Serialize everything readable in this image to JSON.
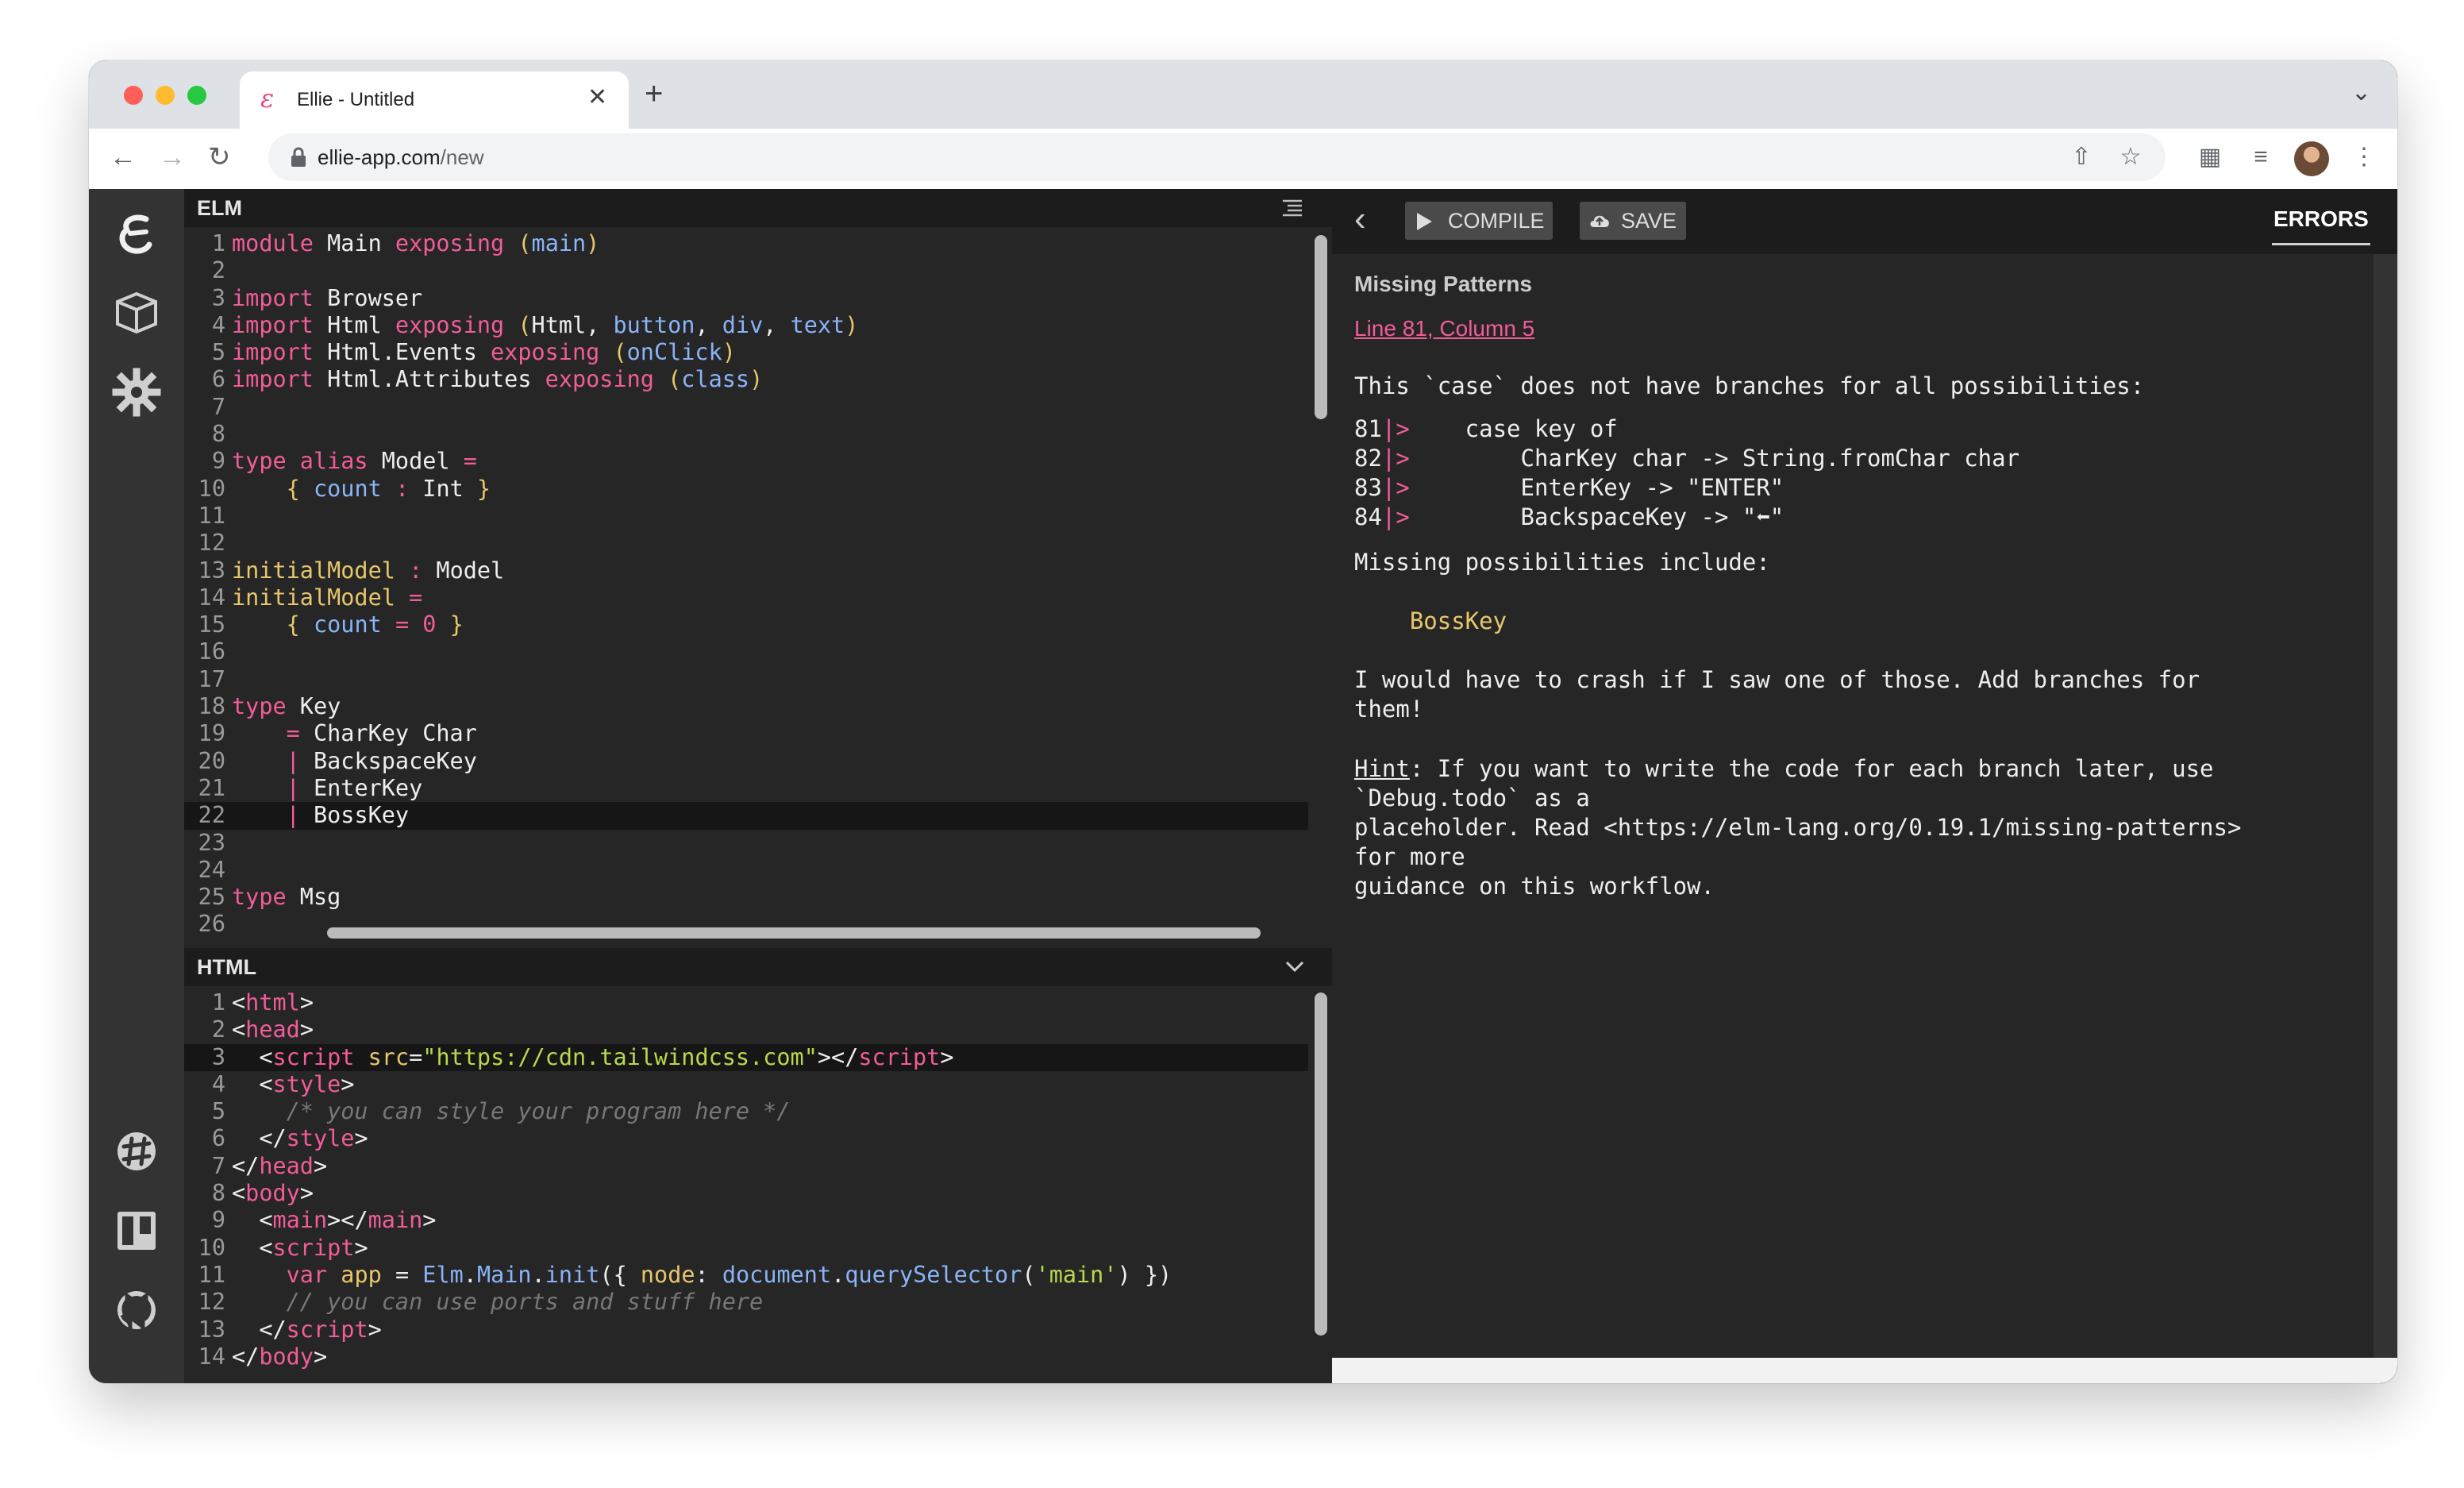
{
  "browser": {
    "tab_title": "Ellie - Untitled",
    "tab_favicon": "ε",
    "new_tab_glyph": "+",
    "tab_close_glyph": "✕",
    "tabstrip_menu_glyph": "⌄",
    "url_domain": "ellie-app.com",
    "url_path": "/new",
    "traffic_colors": [
      "#ff5f57",
      "#febc2e",
      "#28c840"
    ]
  },
  "sidebar": {
    "icons": [
      "ellie-logo-icon",
      "package-icon",
      "gear-icon",
      "slack-icon",
      "trello-icon",
      "github-icon"
    ]
  },
  "elm_pane": {
    "title": "ELM",
    "lines": [
      {
        "n": "1",
        "html": "<span class='kw'>module</span> Main <span class='kw'>exposing</span> <span class='attr'>(</span><span class='fld'>main</span><span class='attr'>)</span>"
      },
      {
        "n": "2",
        "html": ""
      },
      {
        "n": "3",
        "html": "<span class='kw'>import</span> Browser"
      },
      {
        "n": "4",
        "html": "<span class='kw'>import</span> Html <span class='kw'>exposing</span> <span class='attr'>(</span>Html, <span class='imp'>button</span>, <span class='imp'>div</span>, <span class='imp'>text</span><span class='attr'>)</span>"
      },
      {
        "n": "5",
        "html": "<span class='kw'>import</span> Html.Events <span class='kw'>exposing</span> <span class='attr'>(</span><span class='imp'>onClick</span><span class='attr'>)</span>"
      },
      {
        "n": "6",
        "html": "<span class='kw'>import</span> Html.Attributes <span class='kw'>exposing</span> <span class='attr'>(</span><span class='imp'>class</span><span class='attr'>)</span>"
      },
      {
        "n": "7",
        "html": ""
      },
      {
        "n": "8",
        "html": ""
      },
      {
        "n": "9",
        "html": "<span class='kw'>type alias</span> Model <span class='kw'>=</span>"
      },
      {
        "n": "10",
        "html": "    <span class='attr'>{</span> <span class='fld'>count</span> <span class='kw'>:</span> Int <span class='attr'>}</span>"
      },
      {
        "n": "11",
        "html": ""
      },
      {
        "n": "12",
        "html": ""
      },
      {
        "n": "13",
        "html": "<span class='attr'>initialModel</span> <span class='kw'>:</span> Model"
      },
      {
        "n": "14",
        "html": "<span class='attr'>initialModel</span> <span class='kw'>=</span>"
      },
      {
        "n": "15",
        "html": "    <span class='attr'>{</span> <span class='fld'>count</span> <span class='kw'>=</span> <span class='num'>0</span> <span class='attr'>}</span>"
      },
      {
        "n": "16",
        "html": ""
      },
      {
        "n": "17",
        "html": ""
      },
      {
        "n": "18",
        "html": "<span class='kw'>type</span> Key"
      },
      {
        "n": "19",
        "html": "    <span class='kw'>=</span> CharKey Char"
      },
      {
        "n": "20",
        "html": "    <span class='kw'>|</span> BackspaceKey"
      },
      {
        "n": "21",
        "html": "    <span class='kw'>|</span> EnterKey"
      },
      {
        "n": "22",
        "html": "    <span class='kw'>|</span> BossKey",
        "active": true
      },
      {
        "n": "23",
        "html": ""
      },
      {
        "n": "24",
        "html": ""
      },
      {
        "n": "25",
        "html": "<span class='kw'>type</span> Msg"
      },
      {
        "n": "26",
        "html": ""
      }
    ]
  },
  "html_pane": {
    "title": "HTML",
    "lines": [
      {
        "n": "1",
        "html": "<span class='ty'>&lt;</span><span class='tag'>html</span><span class='ty'>&gt;</span>"
      },
      {
        "n": "2",
        "html": "<span class='ty'>&lt;</span><span class='tag'>head</span><span class='ty'>&gt;</span>"
      },
      {
        "n": "3",
        "html": "  <span class='ty'>&lt;</span><span class='tag'>script</span> <span class='attr'>src</span><span class='ty'>=</span><span class='str'>\"https://cdn.tailwindcss.com\"</span><span class='ty'>&gt;&lt;/</span><span class='tag'>script</span><span class='ty'>&gt;</span>",
        "active": true
      },
      {
        "n": "4",
        "html": "  <span class='ty'>&lt;</span><span class='tag'>style</span><span class='ty'>&gt;</span>"
      },
      {
        "n": "5",
        "html": "    <span class='cmt'>/* you can style your program here */</span>"
      },
      {
        "n": "6",
        "html": "  <span class='ty'>&lt;/</span><span class='tag'>style</span><span class='ty'>&gt;</span>"
      },
      {
        "n": "7",
        "html": "<span class='ty'>&lt;/</span><span class='tag'>head</span><span class='ty'>&gt;</span>"
      },
      {
        "n": "8",
        "html": "<span class='ty'>&lt;</span><span class='tag'>body</span><span class='ty'>&gt;</span>"
      },
      {
        "n": "9",
        "html": "  <span class='ty'>&lt;</span><span class='tag'>main</span><span class='ty'>&gt;&lt;/</span><span class='tag'>main</span><span class='ty'>&gt;</span>"
      },
      {
        "n": "10",
        "html": "  <span class='ty'>&lt;</span><span class='tag'>script</span><span class='ty'>&gt;</span>"
      },
      {
        "n": "11",
        "html": "    <span class='kw'>var</span> <span class='attr'>app</span> <span class='ty'>=</span> <span class='fn'>Elm</span>.<span class='fn'>Main</span>.<span class='fn'>init</span>({ <span class='attr'>node</span>: <span class='fn'>document</span>.<span class='fn'>querySelector</span>(<span class='str'>'main'</span>) })"
      },
      {
        "n": "12",
        "html": "    <span class='cmt'>// you can use ports and stuff here</span>"
      },
      {
        "n": "13",
        "html": "  <span class='ty'>&lt;/</span><span class='tag'>script</span><span class='ty'>&gt;</span>"
      },
      {
        "n": "14",
        "html": "<span class='ty'>&lt;/</span><span class='tag'>body</span><span class='ty'>&gt;</span>"
      }
    ]
  },
  "right_panel": {
    "back_glyph": "‹",
    "compile_label": "COMPILE",
    "save_label": "SAVE",
    "errors_tab": "ERRORS",
    "error": {
      "title": "Missing Patterns",
      "location": "Line 81, Column 5",
      "intro": "This `case` does not have branches for all possibilities:",
      "code": [
        {
          "n": "81",
          "text": "    case key of"
        },
        {
          "n": "82",
          "text": "        CharKey char -> String.fromChar char"
        },
        {
          "n": "83",
          "text": "        EnterKey -> \"ENTER\""
        },
        {
          "n": "84",
          "text": "        BackspaceKey -> \"⬅\""
        }
      ],
      "missing_intro": "Missing possibilities include:",
      "missing_value": "    BossKey",
      "crash_text": "I would have to crash if I saw one of those. Add branches for\nthem!",
      "hint_label": "Hint",
      "hint_text": ": If you want to write the code for each branch later, use\n`Debug.todo` as a\nplaceholder. Read <https://elm-lang.org/0.19.1/missing-patterns>\nfor more\nguidance on this workflow."
    }
  }
}
